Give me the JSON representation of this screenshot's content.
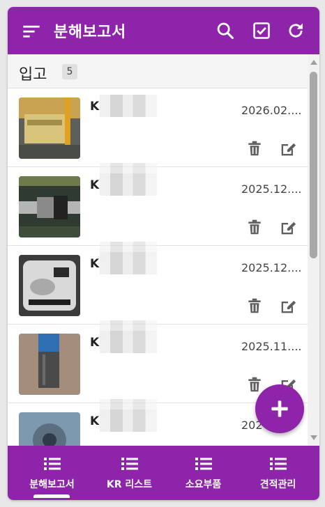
{
  "app": {
    "title": "분해보고서"
  },
  "header_actions": [
    {
      "icon": "search-icon"
    },
    {
      "icon": "checkbox-icon"
    },
    {
      "icon": "refresh-icon"
    }
  ],
  "section": {
    "label": "입고",
    "count": "5"
  },
  "items": [
    {
      "title": "K",
      "date": "2026.02....",
      "thumb_color": "#c9a352"
    },
    {
      "title": "K",
      "date": "2025.12....",
      "thumb_color": "#3a3f3a"
    },
    {
      "title": "K",
      "date": "2025.12....",
      "thumb_color": "#c8c8c8"
    },
    {
      "title": "K",
      "date": "2025.11....",
      "thumb_color": "#3d6fa8"
    },
    {
      "title": "K",
      "date": "202",
      "thumb_color": "#5d7f9c"
    }
  ],
  "fab": {
    "icon": "plus-icon"
  },
  "bottom_nav": [
    {
      "label": "분해보고서",
      "icon": "list-icon",
      "active": true
    },
    {
      "label": "KR 리스트",
      "icon": "list-icon",
      "active": false
    },
    {
      "label": "소요부품",
      "icon": "list-icon",
      "active": false
    },
    {
      "label": "견적관리",
      "icon": "list-icon",
      "active": false
    }
  ],
  "colors": {
    "primary": "#8e24aa",
    "icon_gray": "#5f5f5f"
  }
}
